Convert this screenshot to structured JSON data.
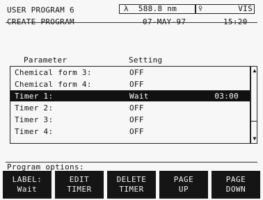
{
  "header": {
    "title": "USER PROGRAM 6",
    "subtitle": "CREATE PROGRAM",
    "wavelength": "λ  588.8 nm",
    "mode_icon": "lamp-icon",
    "mode": "VIS",
    "date": "07-MAY-97",
    "time": "15:20"
  },
  "table": {
    "headers": {
      "parameter": "Parameter",
      "setting": "Setting"
    },
    "rows": [
      {
        "name": "Chemical form 3:",
        "value": "OFF",
        "time": ""
      },
      {
        "name": "Chemical form 4:",
        "value": "OFF",
        "time": ""
      },
      {
        "name": "Timer 1:",
        "value": "Wait",
        "time": "03:00"
      },
      {
        "name": "Timer 2:",
        "value": "OFF",
        "time": ""
      },
      {
        "name": "Timer 3:",
        "value": "OFF",
        "time": ""
      },
      {
        "name": "Timer 4:",
        "value": "OFF",
        "time": ""
      }
    ],
    "selected_row": 2
  },
  "status": {
    "text": "Program options:"
  },
  "softkeys": [
    {
      "line1": "LABEL:",
      "line2": "Wait"
    },
    {
      "line1": "EDIT",
      "line2": "TIMER"
    },
    {
      "line1": "DELETE",
      "line2": "TIMER"
    },
    {
      "line1": "PAGE",
      "line2": "UP"
    },
    {
      "line1": "PAGE",
      "line2": "DOWN"
    }
  ],
  "colors": {
    "background": "#f7f7f7",
    "selection": "#111111",
    "softkey_bg": "#151515"
  }
}
